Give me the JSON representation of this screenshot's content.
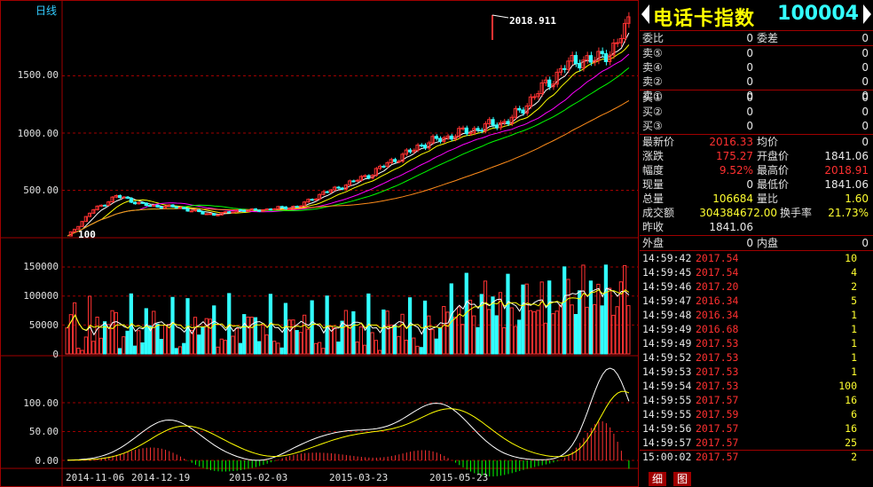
{
  "chart": {
    "period_label": "日线",
    "price_axis": [
      "1500.00",
      "1000.00",
      "500.00"
    ],
    "high_marker": "2018.911",
    "low_marker": "100",
    "volume_axis": [
      "150000",
      "100000",
      "50000",
      "0"
    ],
    "macd_axis": [
      "100.00",
      "50.00",
      "0.00"
    ],
    "dates": [
      "2014-11-06",
      "2014-12-19",
      "2015-02-03",
      "2015-03-23",
      "2015-05-23"
    ],
    "colors": {
      "up": "#ff3232",
      "down": "#32ffff",
      "ma5": "#ffffff",
      "ma10": "#ffff00",
      "ma20": "#ff00ff",
      "ma30": "#00ff00",
      "ma60": "#ff8c1a",
      "grid": "#a00000"
    }
  },
  "quote": {
    "name": "电话卡指数",
    "code": "100004",
    "weibi_label": "委比",
    "weibi": "0",
    "weicha_label": "委差",
    "weicha": "0",
    "asks": [
      {
        "label": "卖⑤",
        "price": "0",
        "vol": "0"
      },
      {
        "label": "卖④",
        "price": "0",
        "vol": "0"
      },
      {
        "label": "卖②",
        "price": "0",
        "vol": "0"
      },
      {
        "label": "卖①",
        "price": "0",
        "vol": "0"
      }
    ],
    "bids": [
      {
        "label": "买①",
        "price": "0",
        "vol": "0"
      },
      {
        "label": "买②",
        "price": "0",
        "vol": "0"
      },
      {
        "label": "买③",
        "price": "0",
        "vol": "0"
      }
    ],
    "latest_label": "最新价",
    "latest": "2016.33",
    "avg_label": "均价",
    "avg": "0",
    "change_label": "涨跌",
    "change": "175.27",
    "open_label": "开盘价",
    "open": "1841.06",
    "pct_label": "幅度",
    "pct": "9.52%",
    "high_label": "最高价",
    "high": "2018.91",
    "cur_label": "现量",
    "cur": "0",
    "low_label": "最低价",
    "low": "1841.06",
    "total_label": "总量",
    "total": "106684",
    "ratio_label": "量比",
    "ratio": "1.60",
    "amount_label": "成交额",
    "amount": "304384672.00",
    "turnover_label": "换手率",
    "turnover": "21.73%",
    "prev_label": "昨收",
    "prev": "1841.06",
    "outer_label": "外盘",
    "outer": "0",
    "inner_label": "内盘",
    "inner": "0"
  },
  "ticks": [
    {
      "t": "14:59:42",
      "p": "2017.54",
      "v": "10"
    },
    {
      "t": "14:59:45",
      "p": "2017.54",
      "v": "4"
    },
    {
      "t": "14:59:46",
      "p": "2017.20",
      "v": "2"
    },
    {
      "t": "14:59:47",
      "p": "2016.34",
      "v": "5"
    },
    {
      "t": "14:59:48",
      "p": "2016.34",
      "v": "1"
    },
    {
      "t": "14:59:49",
      "p": "2016.68",
      "v": "1"
    },
    {
      "t": "14:59:49",
      "p": "2017.53",
      "v": "1"
    },
    {
      "t": "14:59:52",
      "p": "2017.53",
      "v": "1"
    },
    {
      "t": "14:59:53",
      "p": "2017.53",
      "v": "1"
    },
    {
      "t": "14:59:54",
      "p": "2017.53",
      "v": "100"
    },
    {
      "t": "14:59:55",
      "p": "2017.57",
      "v": "16"
    },
    {
      "t": "14:59:55",
      "p": "2017.59",
      "v": "6"
    },
    {
      "t": "14:59:56",
      "p": "2017.57",
      "v": "16"
    },
    {
      "t": "14:59:57",
      "p": "2017.57",
      "v": "25"
    },
    {
      "t": "15:00:02",
      "p": "2017.57",
      "v": "2"
    }
  ],
  "tabs": {
    "detail": "细",
    "chart": "图"
  }
}
